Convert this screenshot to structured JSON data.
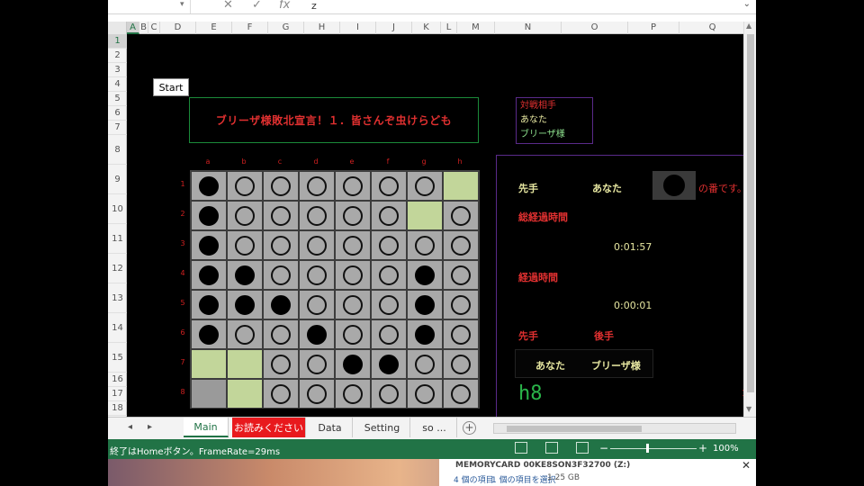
{
  "formula_bar": {
    "value": "z",
    "fx_label": "fx",
    "cancel_glyph": "✕",
    "enter_glyph": "✓"
  },
  "columns": [
    "A",
    "B",
    "C",
    "D",
    "E",
    "F",
    "G",
    "H",
    "I",
    "J",
    "K",
    "L",
    "M",
    "N",
    "O",
    "P",
    "Q"
  ],
  "rows": [
    "1",
    "2",
    "3",
    "4",
    "5",
    "6",
    "7",
    "8",
    "9",
    "10",
    "11",
    "12",
    "13",
    "14",
    "15",
    "16",
    "17",
    "18"
  ],
  "start_button": "Start",
  "banner": "ブリーザ様敗北宣言！１．皆さんぞ虫けらども",
  "legend": {
    "line1": "対戦相手",
    "line2": "あなた",
    "line3": "ブリーザ様"
  },
  "board": {
    "col_labels": [
      "a",
      "b",
      "c",
      "d",
      "e",
      "f",
      "g",
      "h"
    ],
    "row_labels": [
      "1",
      "2",
      "3",
      "4",
      "5",
      "6",
      "7",
      "8"
    ],
    "cells": [
      [
        "B",
        "W",
        "W",
        "W",
        "W",
        "W",
        "W",
        "H"
      ],
      [
        "B",
        "W",
        "W",
        "W",
        "W",
        "W",
        "H",
        "W"
      ],
      [
        "B",
        "W",
        "W",
        "W",
        "W",
        "W",
        "W",
        "W"
      ],
      [
        "B",
        "B",
        "W",
        "W",
        "W",
        "W",
        "B",
        "W"
      ],
      [
        "B",
        "B",
        "B",
        "W",
        "W",
        "W",
        "B",
        "W"
      ],
      [
        "B",
        "W",
        "W",
        "B",
        "W",
        "W",
        "B",
        "W"
      ],
      [
        "H",
        "H",
        "W",
        "W",
        "B",
        "B",
        "W",
        "W"
      ],
      [
        "C",
        "H",
        "W",
        "W",
        "W",
        "W",
        "W",
        "W"
      ]
    ]
  },
  "info": {
    "first_label": "先手",
    "first_player": "あなた",
    "turn_text": "の番です。",
    "total_time_label": "総経過時間",
    "total_time": "0:01:57",
    "elapsed_label": "経過時間",
    "elapsed": "0:00:01",
    "sente_label": "先手",
    "gote_label": "後手",
    "sente_player": "あなた",
    "gote_player": "ブリーザ様",
    "last_move": "h8",
    "side_mark": "1"
  },
  "tabs": [
    "Main",
    "お読みください",
    "Data",
    "Setting",
    "so ..."
  ],
  "tab_nav": {
    "prev": "◂",
    "next": "▸"
  },
  "add_tab": "+",
  "status": {
    "message": "終了はHomeボタン。FrameRate=29ms",
    "zoom": "100%",
    "zoom_minus": "−",
    "zoom_plus": "+"
  },
  "explorer": {
    "title": "MEMORYCARD 00KE8SON3F32700 (Z:)",
    "items": "4 個の項目",
    "selection": "1 個の項目を選択",
    "size": "1.25 GB"
  },
  "colors": {
    "accent": "#217346",
    "black_stone": "#000000",
    "hint": "#c2d69a",
    "board": "#a9a9a9"
  }
}
